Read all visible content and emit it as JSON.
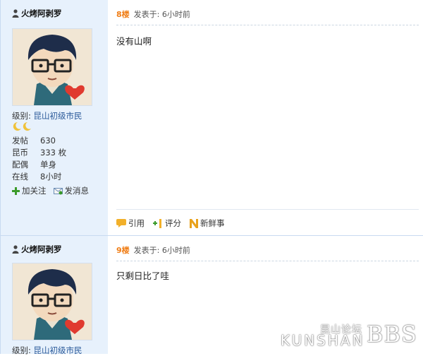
{
  "posts": [
    {
      "username": "火烤阿剥罗",
      "level_label": "级别:",
      "level_value": "昆山初级市民",
      "stats": [
        {
          "key": "发帖",
          "value": "630"
        },
        {
          "key": "昆币",
          "value": "333 枚"
        },
        {
          "key": "配偶",
          "value": "单身"
        },
        {
          "key": "在线",
          "value": "8小时"
        }
      ],
      "follow_label": "加关注",
      "message_label": "发消息",
      "floor": "8楼",
      "posted_label": "发表于: 6小时前",
      "body": "没有山啊",
      "ops": {
        "quote": "引用",
        "rate": "评分",
        "fresh": "新鲜事"
      }
    },
    {
      "username": "火烤阿剥罗",
      "level_label": "级别:",
      "level_value": "昆山初级市民",
      "floor": "9楼",
      "posted_label": "发表于: 6小时前",
      "body": "只剩日比了哇"
    }
  ],
  "watermark": {
    "cn": "昆山论坛",
    "en": "KUNSHAN",
    "bbs": "BBS"
  },
  "colors": {
    "sidebar_bg": "#e7f1fc",
    "floor": "#f07e17",
    "border": "#c8daf0"
  }
}
